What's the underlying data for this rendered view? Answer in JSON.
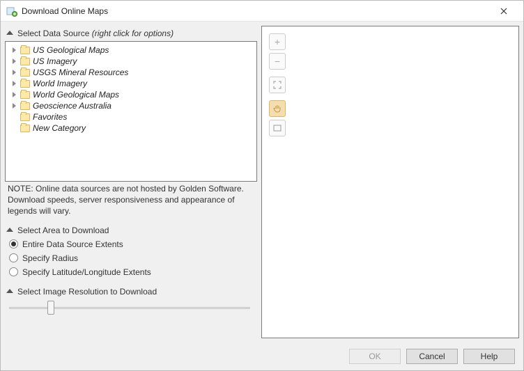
{
  "window": {
    "title": "Download Online Maps"
  },
  "sections": {
    "source": {
      "title": "Select Data Source ",
      "hint": "(right click for options)"
    },
    "area": {
      "title": "Select Area to Download"
    },
    "resolution": {
      "title": "Select Image Resolution to Download"
    }
  },
  "tree": {
    "items": [
      {
        "label": "US Geological Maps",
        "expandable": true
      },
      {
        "label": "US Imagery",
        "expandable": true
      },
      {
        "label": "USGS Mineral Resources",
        "expandable": true
      },
      {
        "label": "World Imagery",
        "expandable": true
      },
      {
        "label": "World Geological Maps",
        "expandable": true
      },
      {
        "label": "Geoscience Australia",
        "expandable": true
      },
      {
        "label": "Favorites",
        "expandable": false
      },
      {
        "label": "New Category",
        "expandable": false
      }
    ]
  },
  "note": "NOTE: Online data sources are not hosted by Golden Software. Download speeds, server responsiveness and appearance of legends will vary.",
  "area_options": [
    {
      "label": "Entire Data Source Extents",
      "selected": true
    },
    {
      "label": "Specify Radius",
      "selected": false
    },
    {
      "label": "Specify Latitude/Longitude Extents",
      "selected": false
    }
  ],
  "slider": {
    "position_pct": 16
  },
  "buttons": {
    "ok": "OK",
    "cancel": "Cancel",
    "help": "Help"
  },
  "map_controls": {
    "zoom_in": "+",
    "zoom_out": "−"
  }
}
